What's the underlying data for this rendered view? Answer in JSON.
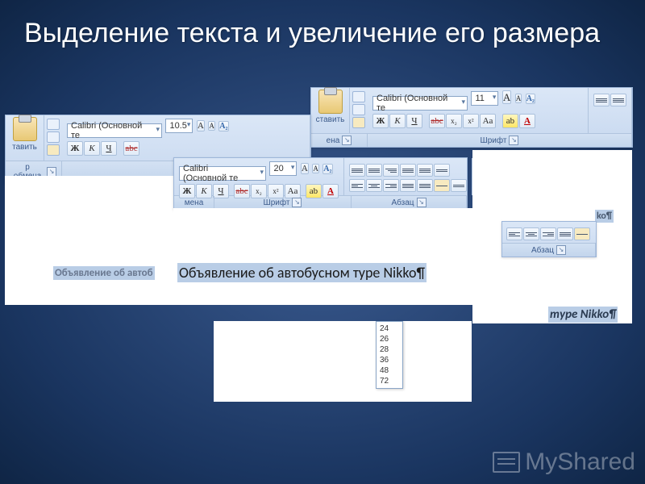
{
  "slide": {
    "title": "Выделение текста и увеличение его размера"
  },
  "ribbon_top": {
    "paste": "ставить",
    "clip_group": "ена",
    "font_name": "Calibri (Основной те",
    "font_size": "11",
    "font_group": "Шрифт",
    "bold": "Ж",
    "italic": "К",
    "underline": "Ч",
    "strike": "abc",
    "sub": "x₂",
    "sup": "x²",
    "case": "Aa",
    "grow": "A",
    "shrink": "A",
    "clear": "A₂",
    "highlight": "ab",
    "fontcolor": "A"
  },
  "ribbon_mid": {
    "paste": "тавить",
    "clip_group": "р обмена",
    "font_name": "Calibri (Основной те",
    "font_size": "10.5",
    "font_group_short": "Шр",
    "buffer_short": "мена"
  },
  "ribbon_front": {
    "font_name": "Calibri (Основной те",
    "font_size": "20",
    "font_group": "Шрифт",
    "para_group": "Абзац",
    "bold": "Ж",
    "italic": "К",
    "underline": "Ч",
    "strike": "abc",
    "sub": "x₂",
    "sup": "x²",
    "case": "Aa",
    "highlight": "ab",
    "fontcolor": "A"
  },
  "snippet_r1": {
    "text": "ko¶"
  },
  "snippet_r2": {
    "para_group": "Абзац"
  },
  "doc_left": {
    "text": "Объявление об автоб"
  },
  "doc_front": {
    "text": "Объявление об автобусном туре Nikko¶"
  },
  "doc_right": {
    "text": "туре Nikko¶"
  },
  "size_list": [
    "24",
    "26",
    "28",
    "36",
    "48",
    "72"
  ],
  "watermark": "MyShared"
}
